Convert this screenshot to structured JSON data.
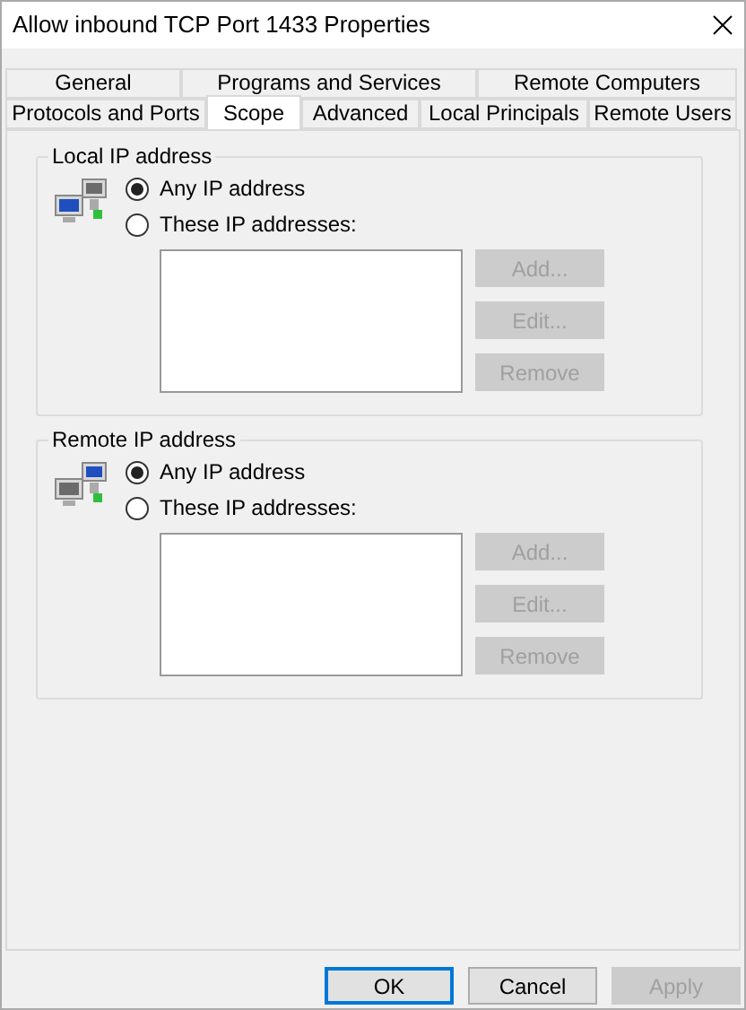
{
  "window": {
    "title": "Allow inbound TCP Port 1433 Properties"
  },
  "tab_rows": [
    {
      "tabs": [
        {
          "label": "General",
          "selected": false
        },
        {
          "label": "Programs and Services",
          "selected": false
        },
        {
          "label": "Remote Computers",
          "selected": false
        }
      ]
    },
    {
      "tabs": [
        {
          "label": "Protocols and Ports",
          "selected": false
        },
        {
          "label": "Scope",
          "selected": true
        },
        {
          "label": "Advanced",
          "selected": false
        },
        {
          "label": "Local Principals",
          "selected": false
        },
        {
          "label": "Remote Users",
          "selected": false
        }
      ]
    }
  ],
  "groups": [
    {
      "title": "Local IP address",
      "kind": "local",
      "options": [
        {
          "label": "Any IP address",
          "selected": true
        },
        {
          "label": "These IP addresses:",
          "selected": false
        }
      ],
      "buttons": [
        {
          "label": "Add...",
          "disabled": true
        },
        {
          "label": "Edit...",
          "disabled": true
        },
        {
          "label": "Remove",
          "disabled": true
        }
      ]
    },
    {
      "title": "Remote IP address",
      "kind": "remote",
      "options": [
        {
          "label": "Any IP address",
          "selected": true
        },
        {
          "label": "These IP addresses:",
          "selected": false
        }
      ],
      "buttons": [
        {
          "label": "Add...",
          "disabled": true
        },
        {
          "label": "Edit...",
          "disabled": true
        },
        {
          "label": "Remove",
          "disabled": true
        }
      ]
    }
  ],
  "footer_buttons": [
    {
      "label": "OK",
      "default": true,
      "disabled": false
    },
    {
      "label": "Cancel",
      "default": false,
      "disabled": false
    },
    {
      "label": "Apply",
      "default": false,
      "disabled": true
    }
  ]
}
